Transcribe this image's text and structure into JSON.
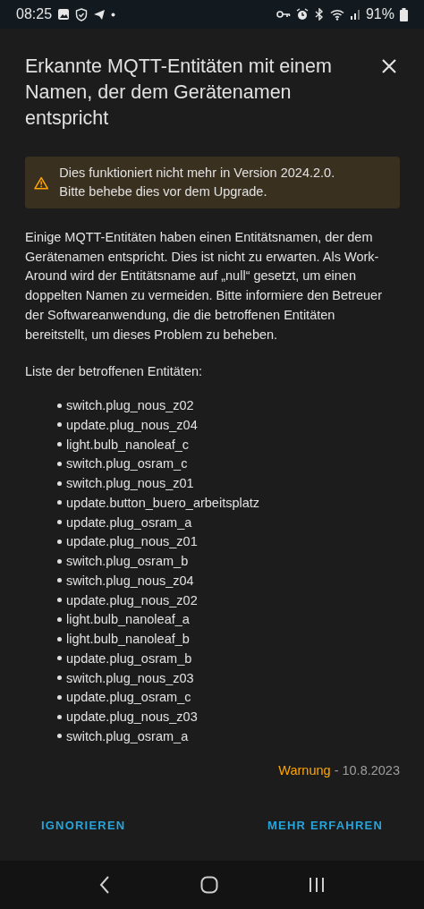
{
  "status_bar": {
    "time": "08:25",
    "battery": "91%"
  },
  "dialog": {
    "title": "Erkannte MQTT-Entitäten mit einem Namen, der dem Gerätenamen entspricht",
    "alert": {
      "kind": "warning",
      "text": "Dies funktioniert nicht mehr in Version 2024.2.0. Bitte behebe dies vor dem Upgrade."
    },
    "description": "Einige MQTT-Entitäten haben einen Entitätsnamen, der dem Gerätenamen entspricht. Dies ist nicht zu erwarten. Als Work-Around wird der Entitätsname auf „null“ gesetzt, um einen doppelten Namen zu vermeiden. Bitte informiere den Betreuer der Softwareanwendung, die die betroffenen Entitäten bereitstellt, um dieses Problem zu beheben.",
    "list_heading": "Liste der betroffenen Entitäten:",
    "entities": [
      "switch.plug_nous_z02",
      "update.plug_nous_z04",
      "light.bulb_nanoleaf_c",
      "switch.plug_osram_c",
      "switch.plug_nous_z01",
      "update.button_buero_arbeitsplatz",
      "update.plug_osram_a",
      "update.plug_nous_z01",
      "switch.plug_osram_b",
      "switch.plug_nous_z04",
      "update.plug_nous_z02",
      "light.bulb_nanoleaf_a",
      "light.bulb_nanoleaf_b",
      "update.plug_osram_b",
      "switch.plug_nous_z03",
      "update.plug_osram_c",
      "update.plug_nous_z03",
      "switch.plug_osram_a"
    ],
    "footer": {
      "severity": "Warnung",
      "separator": "-",
      "date": "10.8.2023"
    },
    "buttons": [
      "IGNORIEREN",
      "MEHR ERFAHREN"
    ]
  }
}
